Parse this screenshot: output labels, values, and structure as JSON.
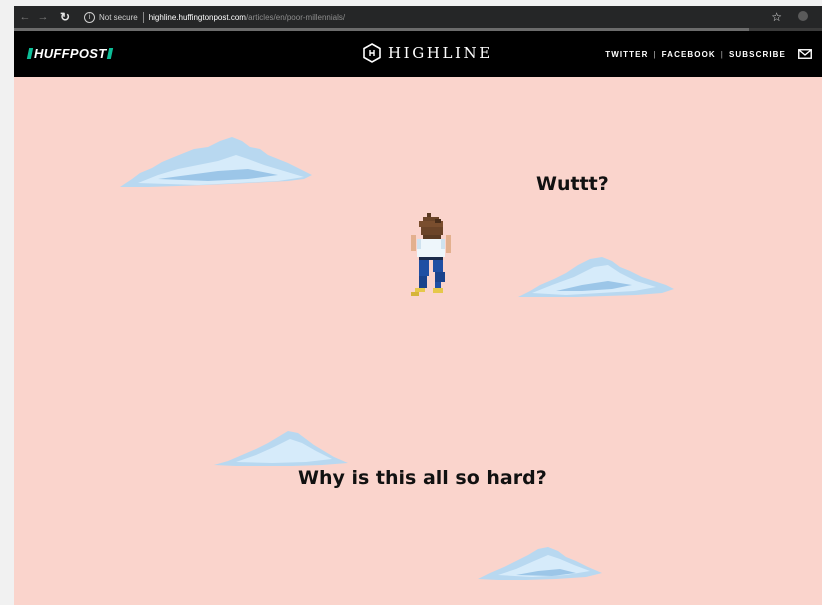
{
  "browser": {
    "security_label": "Not secure",
    "url_host": "highline.huffingtonpost.com",
    "url_path": "/articles/en/poor-millennials/",
    "load_progress": 0.91,
    "icons": [
      "back-arrow-icon",
      "forward-arrow-icon",
      "reload-icon",
      "info-icon",
      "star-icon",
      "extension-icon"
    ]
  },
  "header": {
    "logo_text": "HUFFPOST",
    "brand_accent": "#0dbe98",
    "section_title": "HIGHLINE",
    "nav": {
      "twitter": "TWITTER",
      "facebook": "FACEBOOK",
      "subscribe": "SUBSCRIBE",
      "separator": "|"
    }
  },
  "scene": {
    "background": "#fad4cc",
    "captions": {
      "first": "Wuttt?",
      "second": "Why is this all so hard?"
    }
  }
}
